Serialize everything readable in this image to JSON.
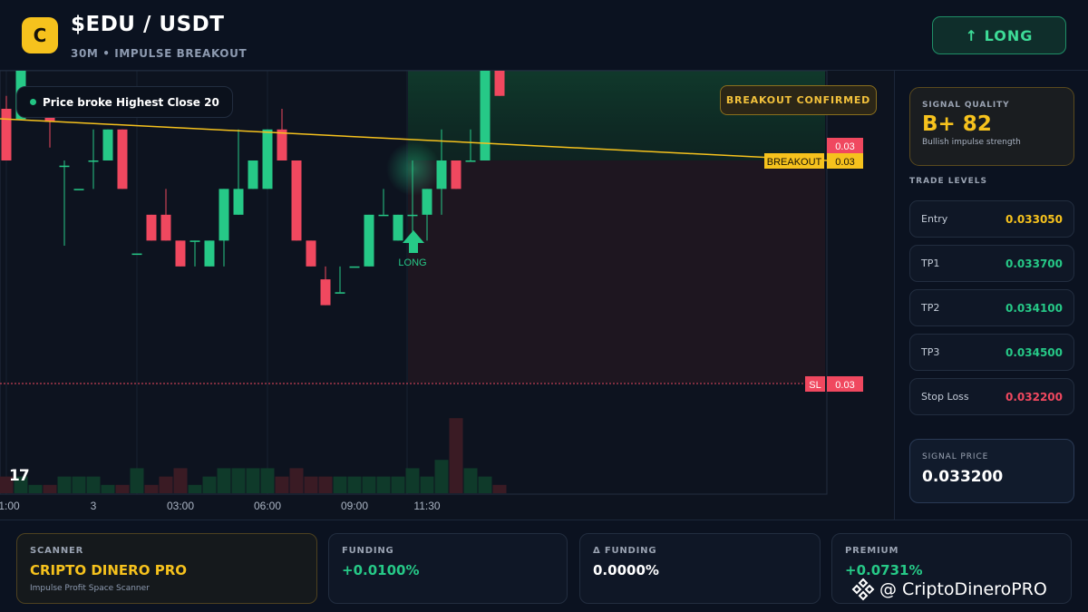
{
  "header": {
    "logo_letter": "C",
    "pair": "$EDU / USDT",
    "subtitle": "30M • IMPULSE BREAKOUT",
    "direction_button": "↑ LONG"
  },
  "chart": {
    "signal_text": "Price broke Highest Close 20",
    "badge": "BREAKOUT CONFIRMED",
    "long_marker": "LONG",
    "breakout_label": "BREAKOUT",
    "sl_label": "SL",
    "price_tag_top": "0.03",
    "price_tag_breakout": "0.03",
    "price_tag_sl": "0.03",
    "tv_logo": "17",
    "x_ticks": [
      "1:00",
      "3",
      "03:00",
      "06:00",
      "09:00",
      "11:30"
    ],
    "colors": {
      "bull": "#26c987",
      "bear": "#f0485f",
      "breakout": "#f6c21d",
      "stoploss": "#f0485f"
    }
  },
  "chart_data": {
    "type": "candlestick",
    "timeframe": "30M",
    "x_ticks": [
      "1:00",
      "3",
      "03:00",
      "06:00",
      "09:00",
      "11:30"
    ],
    "candles": [
      {
        "o": 2,
        "h": 2.5,
        "l": 0,
        "c": 0
      },
      {
        "o": 1.6,
        "h": 3.6,
        "l": 1.6,
        "c": 3.6
      },
      {
        "o": 2.5,
        "h": 2.5,
        "l": 2.5,
        "c": 2.5
      },
      {
        "o": 2.5,
        "h": 2.5,
        "l": 0.5,
        "c": 1.5
      },
      {
        "o": -0.2,
        "h": 0,
        "l": -3.3,
        "c": -0.2
      },
      {
        "o": -1.1,
        "h": -1.1,
        "l": -1.1,
        "c": -1.1
      },
      {
        "o": 0,
        "h": 1.2,
        "l": -1.1,
        "c": 0
      },
      {
        "o": 0,
        "h": 1.2,
        "l": 0,
        "c": 1.2
      },
      {
        "o": 1.2,
        "h": 1.2,
        "l": -1.1,
        "c": -1.1
      },
      {
        "o": -3.6,
        "h": -3.6,
        "l": -3.6,
        "c": -3.6
      },
      {
        "o": -2.1,
        "h": -2.1,
        "l": -3.1,
        "c": -3.1
      },
      {
        "o": -2.1,
        "h": -1.1,
        "l": -3.1,
        "c": -3.1
      },
      {
        "o": -3.1,
        "h": -3.1,
        "l": -4.1,
        "c": -4.1
      },
      {
        "o": -3.1,
        "h": -3.1,
        "l": -4.1,
        "c": -3.1
      },
      {
        "o": -4.1,
        "h": -3.1,
        "l": -4.1,
        "c": -3.1
      },
      {
        "o": -3.1,
        "h": -1.1,
        "l": -4.1,
        "c": -1.1
      },
      {
        "o": -2.1,
        "h": 1.2,
        "l": -2.1,
        "c": -1.1
      },
      {
        "o": -1.1,
        "h": 0,
        "l": -1.1,
        "c": 0
      },
      {
        "o": -1.1,
        "h": 1.2,
        "l": -1.1,
        "c": 1.2
      },
      {
        "o": 1.2,
        "h": 2,
        "l": 0,
        "c": 0
      },
      {
        "o": 0,
        "h": 0,
        "l": -3.1,
        "c": -3.1
      },
      {
        "o": -3.1,
        "h": -3.1,
        "l": -4.1,
        "c": -4.1
      },
      {
        "o": -4.6,
        "h": -4.1,
        "l": -5.6,
        "c": -5.6
      },
      {
        "o": -5.1,
        "h": -4.1,
        "l": -5.1,
        "c": -5.1
      },
      {
        "o": -4.1,
        "h": -4.1,
        "l": -4.1,
        "c": -4.1
      },
      {
        "o": -4.1,
        "h": -2.1,
        "l": -4.1,
        "c": -2.1
      },
      {
        "o": -2.1,
        "h": -1.1,
        "l": -2.1,
        "c": -2.1
      },
      {
        "o": -3.1,
        "h": -2.1,
        "l": -3.1,
        "c": -2.1
      },
      {
        "o": -2.1,
        "h": 0,
        "l": -3.1,
        "c": -2.1
      },
      {
        "o": -2.1,
        "h": -1.1,
        "l": -3.1,
        "c": -1.1
      },
      {
        "o": -1.1,
        "h": 1.2,
        "l": -2.1,
        "c": 0
      },
      {
        "o": 0,
        "h": 0,
        "l": -1.1,
        "c": -1.1
      },
      {
        "o": 0,
        "h": 1.2,
        "l": 0,
        "c": 0
      },
      {
        "o": 0,
        "h": 3.6,
        "l": 0,
        "c": 3.6
      },
      {
        "o": 3.6,
        "h": 3.6,
        "l": 2.5,
        "c": 2.5
      }
    ],
    "volume": [
      2,
      2,
      1,
      1,
      2,
      2,
      2,
      1,
      1,
      3,
      1,
      2,
      3,
      1,
      2,
      3,
      3,
      3,
      3,
      2,
      3,
      2,
      2,
      2,
      2,
      2,
      2,
      2,
      3,
      2,
      4,
      9,
      3,
      2,
      1
    ],
    "levels": {
      "breakout": 1.6,
      "stop_loss": -6.6
    },
    "annotations": [
      "BREAKOUT",
      "SL",
      "LONG"
    ]
  },
  "sidepanel": {
    "quality_label": "SIGNAL QUALITY",
    "quality_grade": "B+ 82",
    "quality_desc": "Bullish impulse strength",
    "levels_title": "TRADE LEVELS",
    "levels": [
      {
        "name": "Entry",
        "value": "0.033050",
        "color": "#f6c21d"
      },
      {
        "name": "TP1",
        "value": "0.033700",
        "color": "#26c987"
      },
      {
        "name": "TP2",
        "value": "0.034100",
        "color": "#26c987"
      },
      {
        "name": "TP3",
        "value": "0.034500",
        "color": "#26c987"
      },
      {
        "name": "Stop Loss",
        "value": "0.032200",
        "color": "#f0485f"
      }
    ],
    "price_label": "SIGNAL PRICE",
    "price_value": "0.033200"
  },
  "footer": {
    "scanner_label": "SCANNER",
    "scanner_name": "CRIPTO DINERO PRO",
    "scanner_sub": "Impulse Profit Space Scanner",
    "funding_label": "FUNDING",
    "funding_value": "+0.0100%",
    "dfunding_label": "Δ FUNDING",
    "dfunding_value": "0.0000%",
    "premium_label": "PREMIUM",
    "premium_value": "+0.0731%",
    "watermark": "@ CriptoDineroPRO"
  }
}
